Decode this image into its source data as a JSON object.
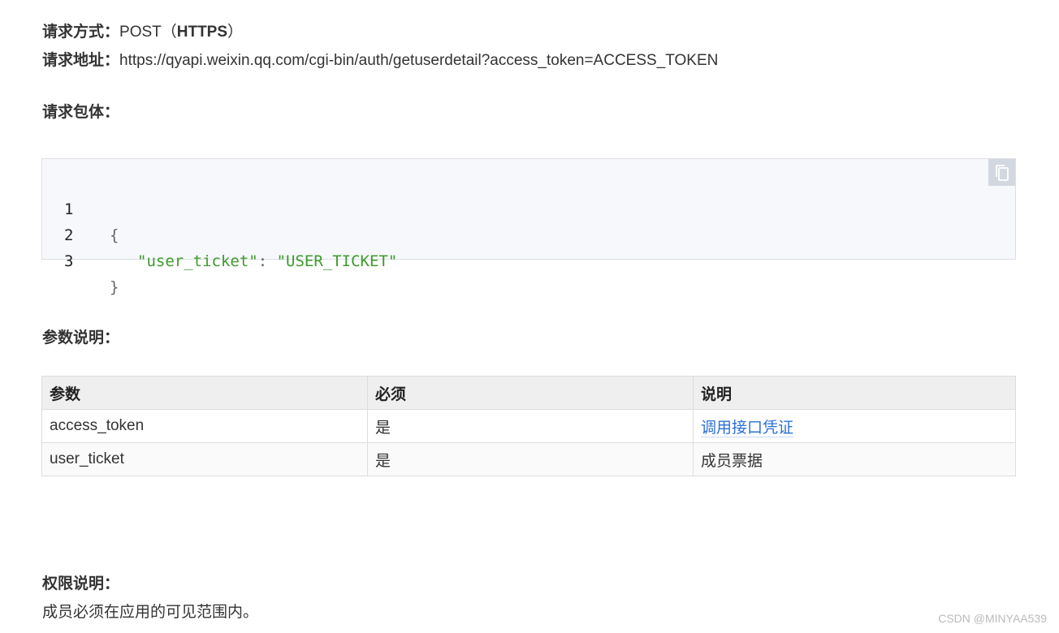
{
  "request": {
    "method_label": "请求方式：",
    "method_value": "POST（",
    "method_protocol": "HTTPS",
    "method_close": "）",
    "url_label": "请求地址：",
    "url_value": "https://qyapi.weixin.qq.com/cgi-bin/auth/getuserdetail?access_token=ACCESS_TOKEN"
  },
  "body_section": {
    "title": "请求包体："
  },
  "code": {
    "lines": [
      {
        "num": "1",
        "open": "{"
      },
      {
        "num": "2",
        "key": "\"user_ticket\"",
        "colon": ": ",
        "value": "\"USER_TICKET\""
      },
      {
        "num": "3",
        "close": "}"
      }
    ],
    "copy_icon": "copy-icon"
  },
  "params_section": {
    "title": "参数说明：",
    "headers": [
      "参数",
      "必须",
      "说明"
    ],
    "rows": [
      {
        "param": "access_token",
        "required": "是",
        "desc": "调用接口凭证",
        "desc_is_link": true
      },
      {
        "param": "user_ticket",
        "required": "是",
        "desc": "成员票据",
        "desc_is_link": false
      }
    ]
  },
  "permission_section": {
    "title": "权限说明：",
    "text": "成员必须在应用的可见范围内。"
  },
  "watermark": "CSDN @MINYAA539",
  "colors": {
    "link": "#2b6fd6",
    "string": "#3c9a2c",
    "code_bg": "#f6f8fb",
    "table_header_bg": "#efefef"
  }
}
